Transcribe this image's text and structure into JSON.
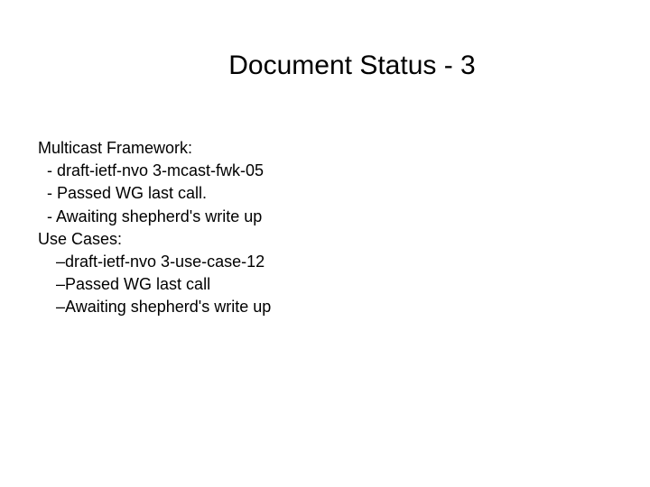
{
  "title": "Document Status - 3",
  "lines": [
    "Multicast Framework:",
    "  - draft-ietf-nvo 3-mcast-fwk-05",
    "  - Passed WG last call.",
    "  - Awaiting shepherd's write up",
    "Use Cases:",
    "    –draft-ietf-nvo 3-use-case-12",
    "    –Passed WG last call",
    "    –Awaiting shepherd's write up"
  ]
}
